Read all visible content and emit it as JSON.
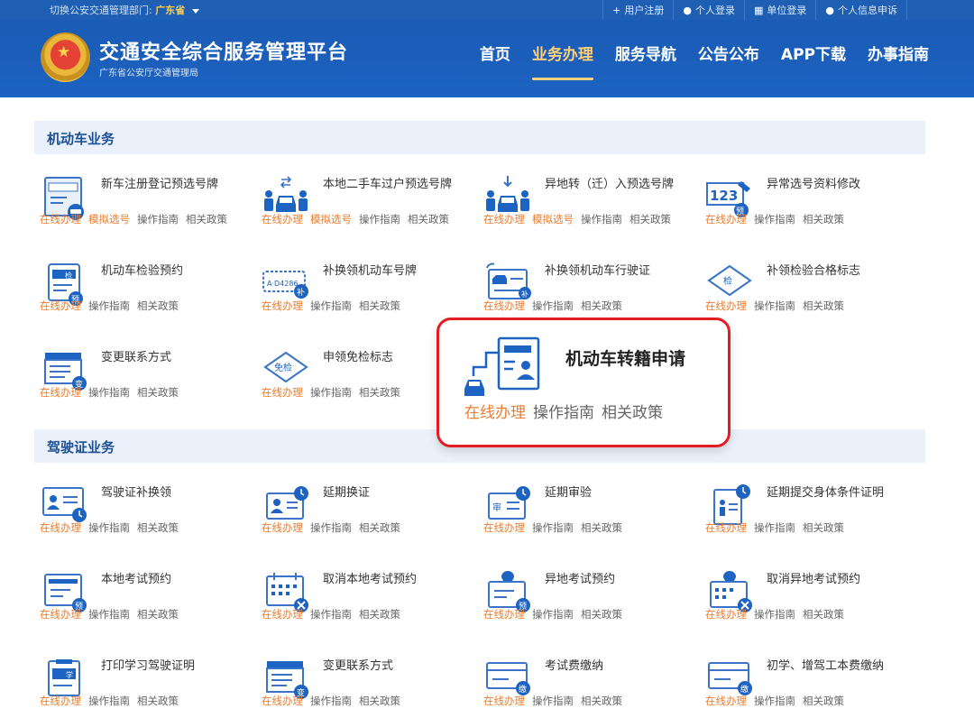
{
  "topbar": {
    "region_prefix": "切换公安交通管理部门:",
    "region_value": "广东省",
    "links": [
      "用户注册",
      "个人登录",
      "单位登录",
      "个人信息申诉"
    ]
  },
  "header": {
    "title": "交通安全综合服务管理平台",
    "subtitle": "广东省公安厅交通管理局",
    "nav": [
      "首页",
      "业务办理",
      "服务导航",
      "公告公布",
      "APP下载",
      "办事指南"
    ]
  },
  "sections": {
    "vehicle": "机动车业务",
    "license": "驾驶证业务"
  },
  "link_labels": {
    "online": "在线办理",
    "sim": "模拟选号",
    "guide": "操作指南",
    "policy": "相关政策"
  },
  "vehicle_items": [
    "新车注册登记预选号牌",
    "本地二手车过户预选号牌",
    "异地转（迁）入预选号牌",
    "异常选号资料修改",
    "机动车检验预约",
    "补换领机动车号牌",
    "补换领机动车行驶证",
    "补领检验合格标志",
    "变更联系方式",
    "申领免检标志"
  ],
  "license_items": [
    "驾驶证补换领",
    "延期换证",
    "延期审验",
    "延期提交身体条件证明",
    "本地考试预约",
    "取消本地考试预约",
    "异地考试预约",
    "取消异地考试预约",
    "打印学习驾驶证明",
    "变更联系方式",
    "考试费缴纳",
    "初学、增驾工本费缴纳"
  ],
  "popup": {
    "title": "机动车转籍申请",
    "links": [
      "在线办理",
      "操作指南",
      "相关政策"
    ]
  },
  "icon_badges": {
    "jian": "检",
    "yu": "预",
    "bu": "补",
    "bian": "变",
    "mianjian": "免检",
    "xue": "学",
    "jiao": "缴",
    "shen": "审",
    "number": "123",
    "plate": "A·D4286"
  },
  "colors": {
    "brand_blue": "#1d63c2",
    "accent_orange": "#ee7c2d",
    "popup_border": "#e31b23",
    "nav_active": "#ffcf7a"
  }
}
